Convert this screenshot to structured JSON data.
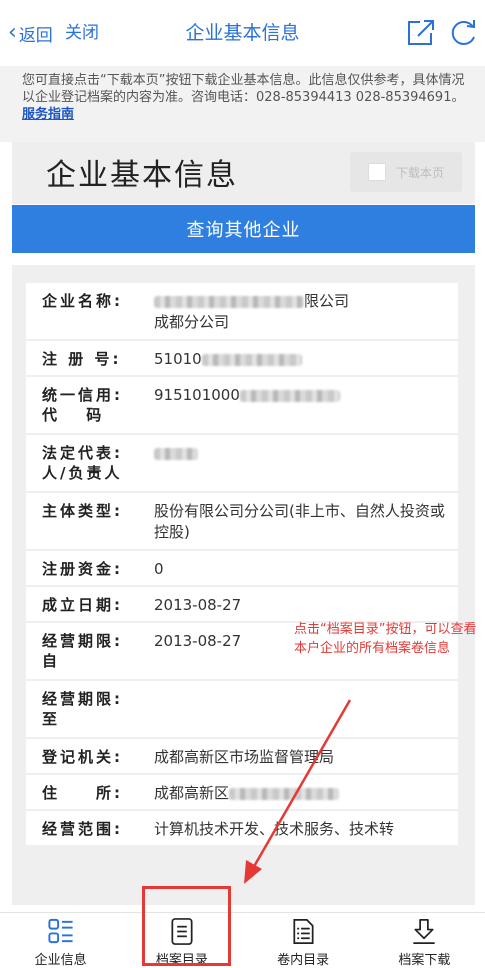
{
  "nav": {
    "back_label": "返回",
    "close_label": "关闭",
    "title": "企业基本信息"
  },
  "notice": {
    "text": "您可直接点击“下载本页”按钮下载企业基本信息。此信息仅供参考，具体情况以企业登记档案的内容为准。咨询电话：028-85394413 028-85394691。",
    "link": "服务指南"
  },
  "header": {
    "heading": "企业基本信息",
    "download_label": "下载本页"
  },
  "query_button": "查询其他企业",
  "info": {
    "company_name_label": "企业名称:",
    "company_name_suffix": "限公司",
    "company_name_line2": "成都分公司",
    "reg_no_label": "注 册 号:",
    "reg_no_prefix": "51010",
    "credit_code_label_1": "统一信用:",
    "credit_code_label_2": "代　 码",
    "credit_code_prefix": "915101000",
    "legal_rep_label_1": "法定代表:",
    "legal_rep_label_2": "人/负责人",
    "entity_type_label": "主体类型:",
    "entity_type_value": "股份有限公司分公司(非上市、自然人投资或控股)",
    "capital_label": "注册资金:",
    "capital_value": "0",
    "established_label": "成立日期:",
    "established_value": "2013-08-27",
    "term_from_label_1": "经营期限:",
    "term_from_label_2": "自",
    "term_from_value": "2013-08-27",
    "term_to_label_1": "经营期限:",
    "term_to_label_2": "至",
    "term_to_value": "",
    "authority_label": "登记机关:",
    "authority_value": "成都高新区市场监督管理局",
    "address_label": "住　　所:",
    "address_prefix": "成都高新区",
    "scope_label": "经营范围:",
    "scope_value": "计算机技术开发、技术服务、技术转"
  },
  "annotation": "点击“档案目录”按钮，可以查看本户企业的所有档案卷信息",
  "tabs": [
    {
      "label": "企业信息",
      "icon": "list-grid-icon"
    },
    {
      "label": "档案目录",
      "icon": "document-lines-icon"
    },
    {
      "label": "卷内目录",
      "icon": "checklist-icon"
    },
    {
      "label": "档案下载",
      "icon": "download-icon"
    }
  ],
  "colors": {
    "accent": "#2a72d8",
    "button_blue": "#2f7fe0",
    "annotation_red": "#e53935"
  }
}
